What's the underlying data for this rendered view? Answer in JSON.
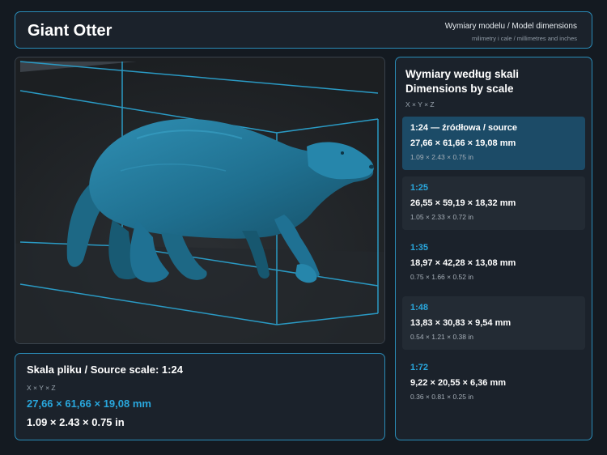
{
  "header": {
    "title": "Giant Otter",
    "subtitle": "Wymiary modelu / Model dimensions",
    "units_note": "milimetry i cale / millimetres and inches"
  },
  "viewport": {
    "model_color": "#1f6f8f",
    "box_color": "#2a9ac4"
  },
  "source": {
    "title": "Skala pliku / Source scale: 1:24",
    "axes": "X × Y × Z",
    "mm": "27,66 × 61,66 × 19,08 mm",
    "inches": "1.09 × 2.43 × 0.75 in"
  },
  "scales": {
    "title_pl": "Wymiary według skali",
    "title_en": "Dimensions by scale",
    "axes": "X × Y × Z",
    "rows": [
      {
        "label": "1:24  —  źródłowa / source",
        "mm": "27,66 × 61,66 × 19,08 mm",
        "inches": "1.09 × 2.43 × 0.75 in"
      },
      {
        "label": "1:25",
        "mm": "26,55 × 59,19 × 18,32 mm",
        "inches": "1.05 × 2.33 × 0.72 in"
      },
      {
        "label": "1:35",
        "mm": "18,97 × 42,28 × 13,08 mm",
        "inches": "0.75 × 1.66 × 0.52 in"
      },
      {
        "label": "1:48",
        "mm": "13,83 × 30,83 × 9,54 mm",
        "inches": "0.54 × 1.21 × 0.38 in"
      },
      {
        "label": "1:72",
        "mm": "9,22 × 20,55 × 6,36 mm",
        "inches": "0.36 × 0.81 × 0.25 in"
      }
    ]
  },
  "colors": {
    "accent": "#29a7dd",
    "active_row": "#1c4b67",
    "panel_border": "#2a8cb8"
  }
}
